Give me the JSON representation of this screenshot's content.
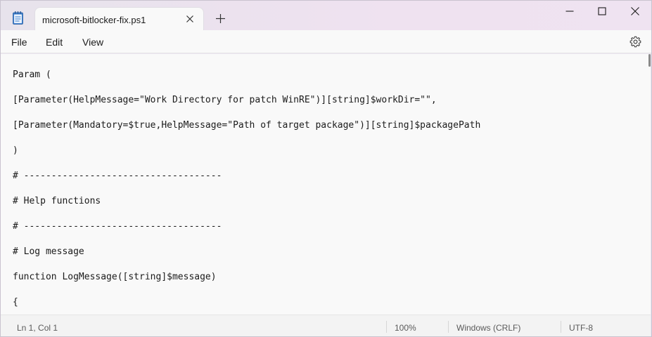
{
  "tabs": [
    {
      "title": "microsoft-bitlocker-fix.ps1"
    }
  ],
  "menu": {
    "file": "File",
    "edit": "Edit",
    "view": "View"
  },
  "editor": {
    "lines": [
      "Param (",
      "[Parameter(HelpMessage=\"Work Directory for patch WinRE\")][string]$workDir=\"\",",
      "[Parameter(Mandatory=$true,HelpMessage=\"Path of target package\")][string]$packagePath",
      ")",
      "# ------------------------------------",
      "# Help functions",
      "# ------------------------------------",
      "# Log message",
      "function LogMessage([string]$message)",
      "{"
    ]
  },
  "status": {
    "position": "Ln 1, Col 1",
    "zoom": "100%",
    "line_ending": "Windows (CRLF)",
    "encoding": "UTF-8"
  },
  "icons": {
    "app": "notepad-icon",
    "tab_close": "close-icon",
    "new_tab": "plus-icon",
    "minimize": "minimize-icon",
    "maximize": "maximize-icon",
    "close": "close-icon",
    "settings": "gear-icon"
  },
  "colors": {
    "titlebar": "#ece6f2",
    "editor_background": "#f9f9f9",
    "text": "#1b1b1b",
    "status_text": "#5a5a5a"
  }
}
